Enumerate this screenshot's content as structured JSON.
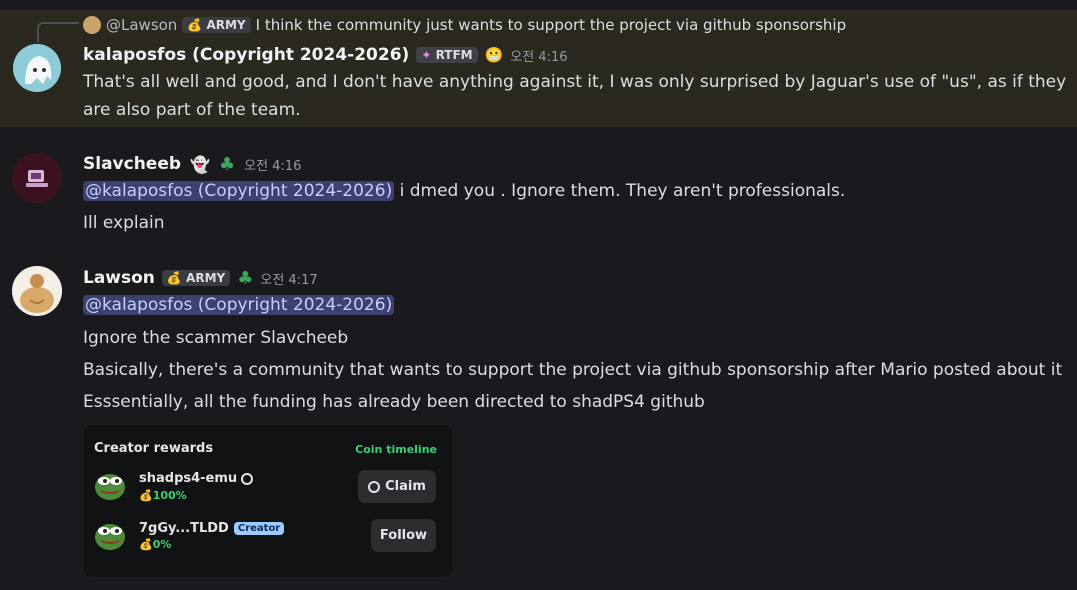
{
  "reply": {
    "author": "@Lawson",
    "badge": "ARMY",
    "text": "I think the community just wants to support the project via github sponsorship"
  },
  "messages": [
    {
      "author": "kalaposfos (Copyright 2024-2026)",
      "badge": "RTFM",
      "time": "오전 4:16",
      "lines": [
        "That's all well and good, and I don't have anything against it, I was only surprised by Jaguar's use of \"us\", as if they",
        "are also part of the team."
      ]
    },
    {
      "author": "Slavcheeb",
      "time": "오전 4:16",
      "mention": "@kalaposfos (Copyright 2024-2026)",
      "line1_rest": " i dmed you . Ignore them. They aren't professionals.",
      "line2": "Ill explain"
    },
    {
      "author": "Lawson",
      "badge": "ARMY",
      "time": "오전 4:17",
      "mention": "@kalaposfos (Copyright 2024-2026)",
      "lines": [
        "Ignore the scammer Slavcheeb",
        "Basically, there's a community that wants to support the project via github sponsorship after Mario posted about it",
        "Esssentially, all the funding has already been directed to shadPS4 github"
      ]
    }
  ],
  "card": {
    "title": "Creator rewards",
    "link": "Coin timeline",
    "rows": [
      {
        "name": "shadps4-emu",
        "pct": "100%",
        "button": "Claim"
      },
      {
        "name": "7gGy...TLDD",
        "tag": "Creator",
        "pct": "0%",
        "button": "Follow"
      }
    ]
  },
  "colors": {
    "accent_green": "#3ecf74",
    "mention_bg": "#3c4270",
    "highlight_bg": "#2b2820"
  }
}
